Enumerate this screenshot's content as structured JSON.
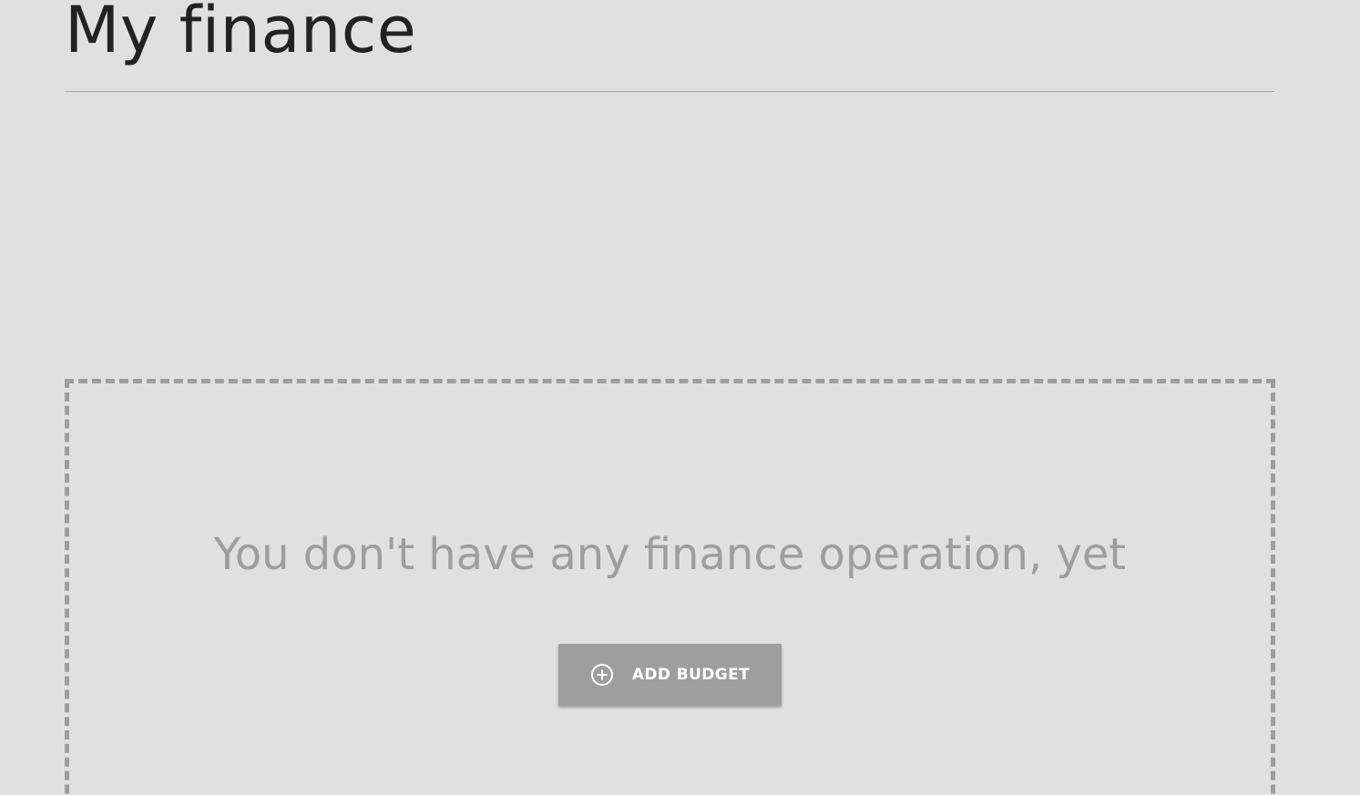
{
  "page": {
    "title": "My finance"
  },
  "empty_state": {
    "message": "You don't have any finance operation, yet",
    "button": {
      "label": "ADD BUDGET",
      "icon": "plus-circle-icon"
    }
  },
  "colors": {
    "background": "#e0e0e0",
    "title_text": "#222222",
    "muted": "#9e9e9e",
    "button_text": "#ffffff"
  }
}
